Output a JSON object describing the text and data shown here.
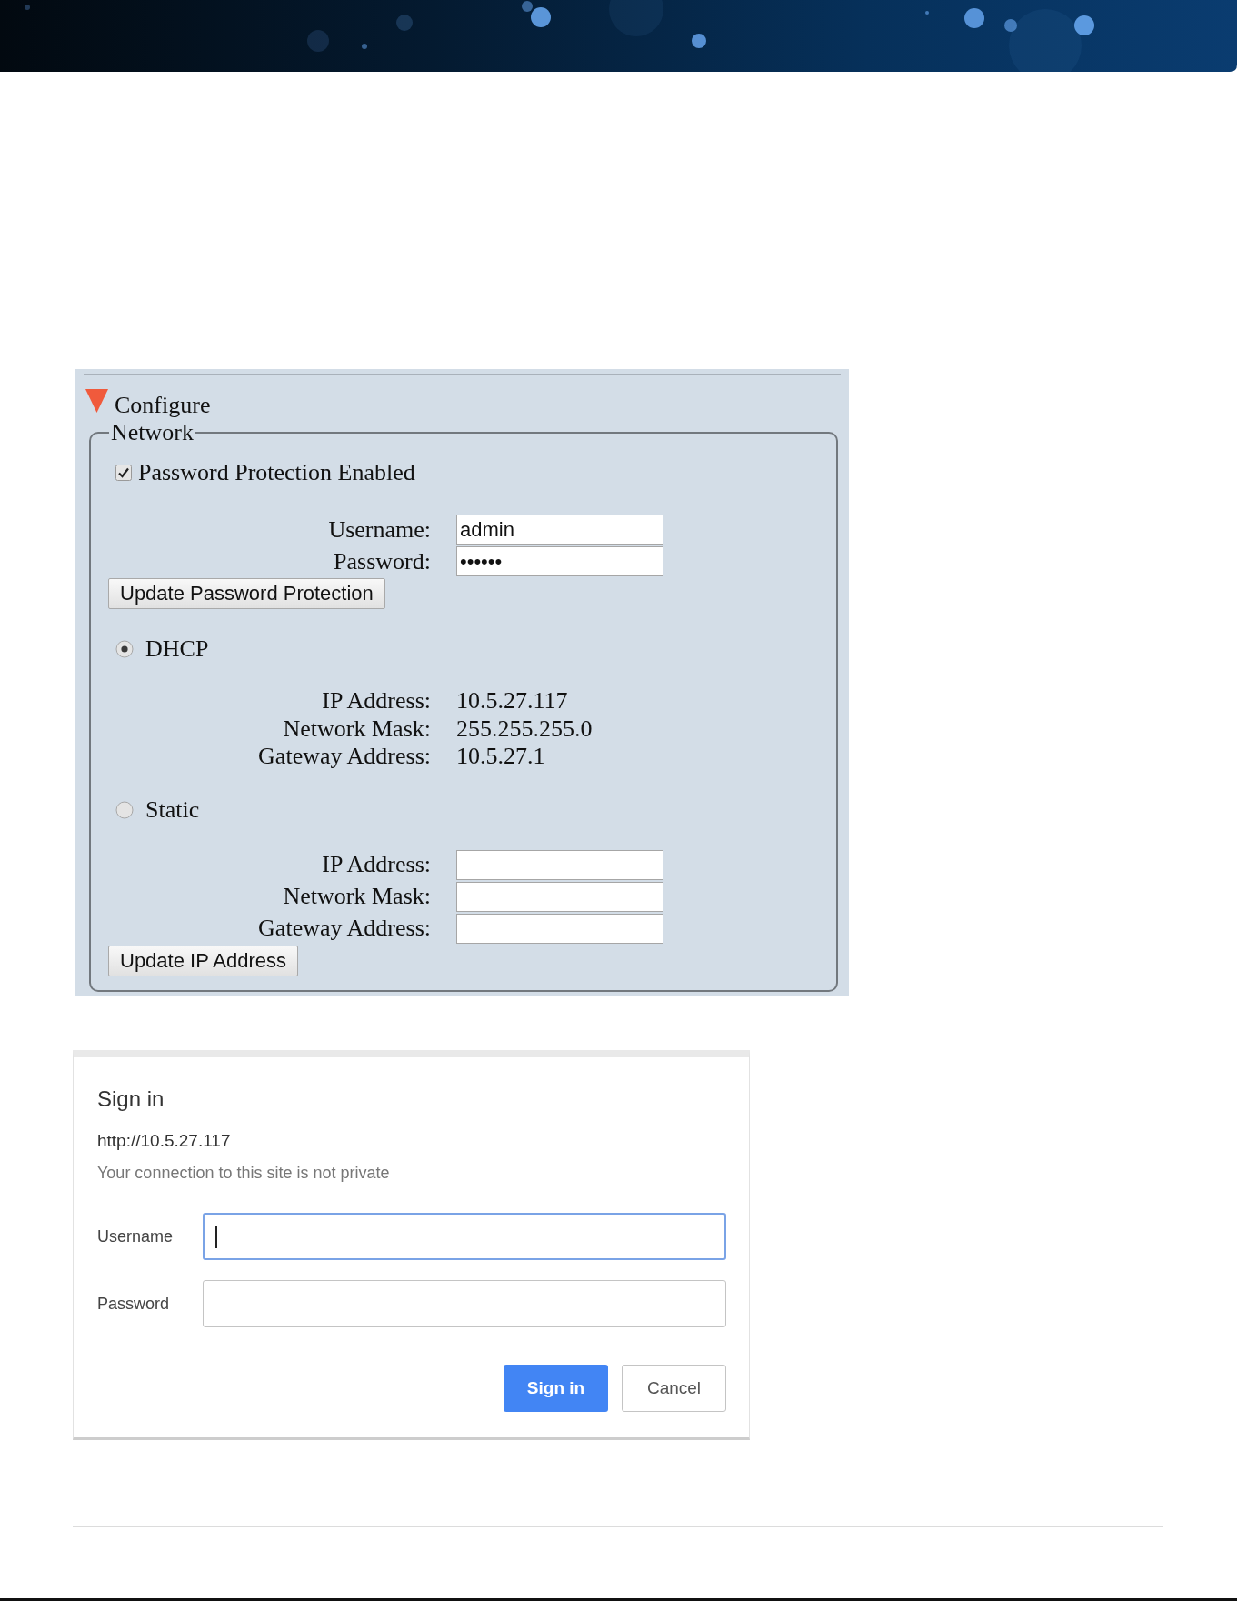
{
  "config": {
    "title": "Configure",
    "expanded": true,
    "legend": "Network",
    "password_protection": {
      "label": "Password Protection Enabled",
      "checked": true
    },
    "credentials": [
      {
        "label": "Username:",
        "value": "admin"
      },
      {
        "label": "Password:",
        "value": "••••••"
      }
    ],
    "update_password_button": "Update Password Protection",
    "modes": [
      {
        "label": "DHCP",
        "selected": true,
        "kind": "readout",
        "fields": [
          {
            "label": "IP Address:",
            "value": "10.5.27.117"
          },
          {
            "label": "Network Mask:",
            "value": "255.255.255.0"
          },
          {
            "label": "Gateway Address:",
            "value": "10.5.27.1"
          }
        ]
      },
      {
        "label": "Static",
        "selected": false,
        "kind": "input",
        "fields": [
          {
            "label": "IP Address:"
          },
          {
            "label": "Network Mask:"
          },
          {
            "label": "Gateway Address:"
          }
        ]
      }
    ],
    "update_ip_button": "Update IP Address"
  },
  "sign_in_dialog": {
    "title": "Sign in",
    "url": "http://10.5.27.117",
    "warning": "Your connection to this site is not private",
    "fields": [
      {
        "label": "Username",
        "focused": true
      },
      {
        "label": "Password",
        "focused": false
      }
    ],
    "buttons": [
      {
        "label": "Sign in",
        "kind": "primary"
      },
      {
        "label": "Cancel",
        "kind": "secondary"
      }
    ]
  }
}
